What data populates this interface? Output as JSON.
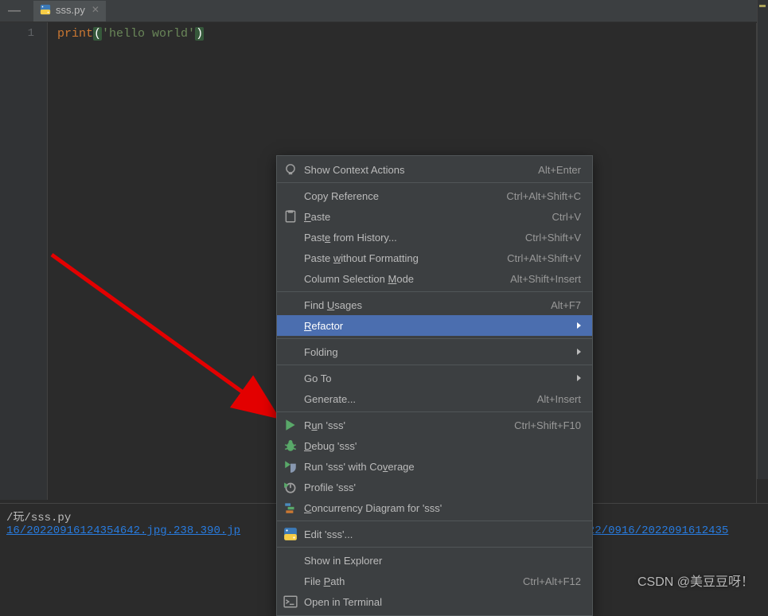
{
  "tab": {
    "filename": "sss.py"
  },
  "editor": {
    "line_number": "1",
    "code_kw": "print",
    "code_lparen": "(",
    "code_str": "'hello world'",
    "code_rparen": ")"
  },
  "bottom": {
    "path_prefix": "/玩/",
    "path_file": "sss.py",
    "link_left": "16/20220916124354642.jpg.238.390.jp",
    "link_right": "22/0916/2022091612435"
  },
  "menu": {
    "show_context": {
      "label": "Show Context Actions",
      "shortcut": "Alt+Enter"
    },
    "copy_ref": {
      "label": "Copy Reference",
      "shortcut": "Ctrl+Alt+Shift+C"
    },
    "paste": {
      "pre": "",
      "u": "P",
      "post": "aste",
      "shortcut": "Ctrl+V"
    },
    "paste_history": {
      "pre": "Past",
      "u": "e",
      "post": " from History...",
      "shortcut": "Ctrl+Shift+V"
    },
    "paste_wo_fmt": {
      "pre": "Paste ",
      "u": "w",
      "post": "ithout Formatting",
      "shortcut": "Ctrl+Alt+Shift+V"
    },
    "col_sel": {
      "pre": "Column Selection ",
      "u": "M",
      "post": "ode",
      "shortcut": "Alt+Shift+Insert"
    },
    "find_usages": {
      "pre": "Find ",
      "u": "U",
      "post": "sages",
      "shortcut": "Alt+F7"
    },
    "refactor": {
      "u": "R",
      "post": "efactor"
    },
    "folding": {
      "label": "Folding"
    },
    "goto": {
      "label": "Go To"
    },
    "generate": {
      "label": "Generate...",
      "shortcut": "Alt+Insert"
    },
    "run": {
      "pre": "R",
      "u": "u",
      "post": "n 'sss'",
      "shortcut": "Ctrl+Shift+F10"
    },
    "debug": {
      "u": "D",
      "post": "ebug 'sss'"
    },
    "coverage": {
      "pre": "Run 'sss' with Co",
      "u": "v",
      "post": "erage"
    },
    "profile": {
      "label": "Profile 'sss'"
    },
    "concurrency": {
      "u": "C",
      "post": "oncurrency Diagram for 'sss'"
    },
    "edit": {
      "label": "Edit 'sss'..."
    },
    "show_explorer": {
      "label": "Show in Explorer"
    },
    "file_path": {
      "pre": "File ",
      "u": "P",
      "post": "ath",
      "shortcut": "Ctrl+Alt+F12"
    },
    "open_terminal": {
      "label": "Open in Terminal"
    }
  },
  "watermark": "CSDN @美豆豆呀！"
}
